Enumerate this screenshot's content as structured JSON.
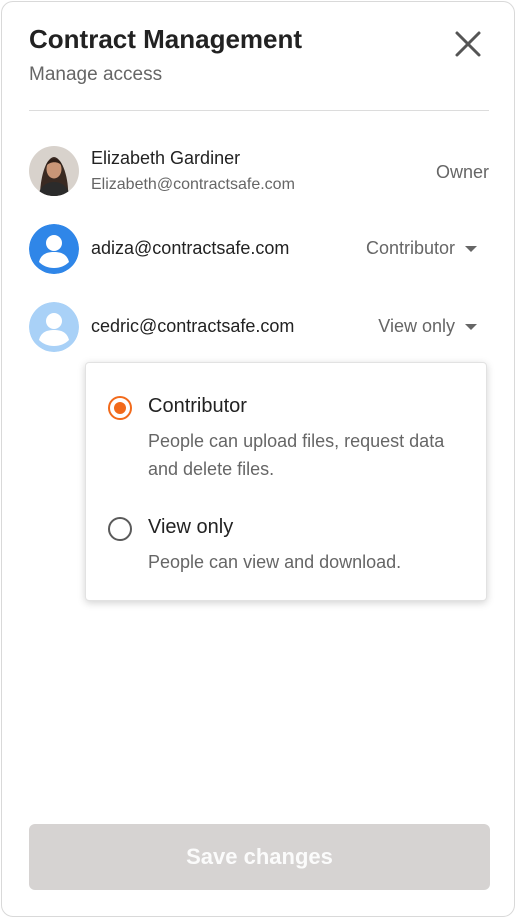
{
  "header": {
    "title": "Contract Management",
    "subtitle": "Manage access",
    "close_icon": "close-icon"
  },
  "members": [
    {
      "name": "Elizabeth Gardiner",
      "email": "Elizabeth@contractsafe.com",
      "role": "Owner",
      "avatar": "photo"
    },
    {
      "email": "adiza@contractsafe.com",
      "role": "Contributor",
      "avatar": "person-icon",
      "avatar_color": "#2f86e8"
    },
    {
      "email": "cedric@contractsafe.com",
      "role": "View only",
      "avatar": "person-icon",
      "avatar_color": "#a9d1f7"
    }
  ],
  "role_menu": {
    "options": [
      {
        "label": "Contributor",
        "description": "People can upload files, request data and delete files.",
        "selected": true
      },
      {
        "label": "View only",
        "description": "People can view and download.",
        "selected": false
      }
    ],
    "accent_color": "#f26a1b"
  },
  "footer": {
    "save_label": "Save changes",
    "save_enabled": false
  }
}
